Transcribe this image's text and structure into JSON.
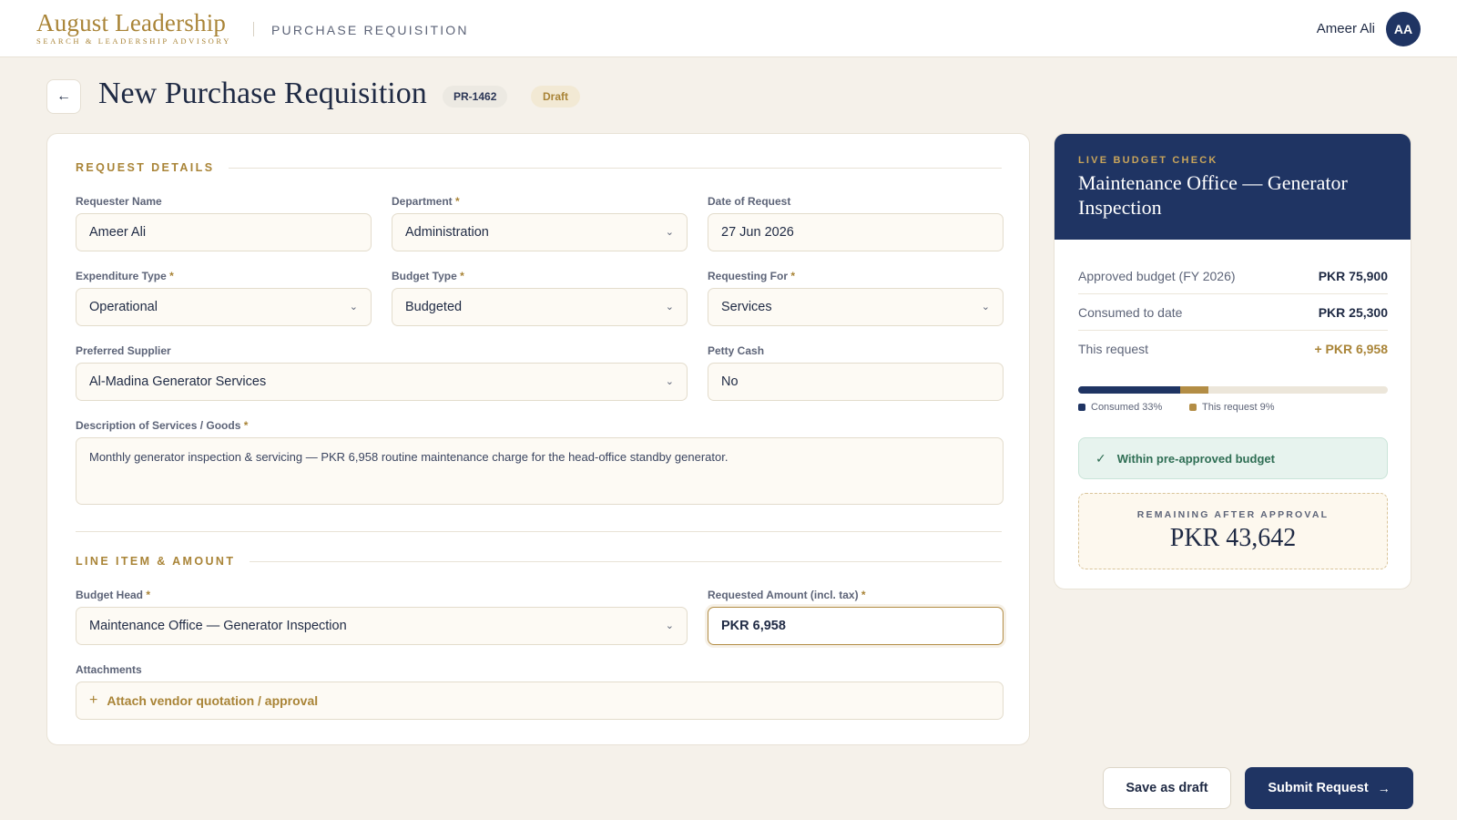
{
  "header": {
    "logo_main": "August Leadership",
    "logo_sub": "SEARCH & LEADERSHIP ADVISORY",
    "module": "PURCHASE REQUISITION",
    "user_name": "Ameer Ali",
    "user_initials": "AA"
  },
  "title_row": {
    "back_icon": "←",
    "title": "New Purchase Requisition",
    "pr_id": "PR-1462",
    "status": "Draft"
  },
  "request_details": {
    "section_title": "REQUEST DETAILS",
    "requester_name": {
      "label": "Requester Name",
      "value": "Ameer Ali"
    },
    "department": {
      "label": "Department",
      "value": "Administration"
    },
    "date_of_request": {
      "label": "Date of Request",
      "value": "27 Jun 2026"
    },
    "expenditure_type": {
      "label": "Expenditure Type",
      "value": "Operational"
    },
    "budget_type": {
      "label": "Budget Type",
      "value": "Budgeted"
    },
    "requesting_for": {
      "label": "Requesting For",
      "value": "Services"
    },
    "preferred_supplier": {
      "label": "Preferred Supplier",
      "value": "Al-Madina Generator Services"
    },
    "petty_cash": {
      "label": "Petty Cash",
      "value": "No"
    },
    "description": {
      "label": "Description of Services / Goods",
      "value": "Monthly generator inspection & servicing — PKR 6,958 routine maintenance charge for the head-office standby generator."
    },
    "required_marker": "*",
    "chevron_icon": "⌄"
  },
  "line_item": {
    "section_title": "LINE ITEM & AMOUNT",
    "budget_head": {
      "label": "Budget Head",
      "value": "Maintenance Office — Generator Inspection"
    },
    "requested_amount": {
      "label": "Requested Amount (incl. tax)",
      "value": "PKR 6,958"
    },
    "attachments": {
      "label": "Attachments",
      "action": "Attach vendor quotation / approval",
      "plus_icon": "+"
    }
  },
  "budget_check": {
    "eyebrow": "LIVE BUDGET CHECK",
    "title": "Maintenance Office — Generator Inspection",
    "approved_label": "Approved budget (FY 2026)",
    "approved_value": "PKR 75,900",
    "consumed_label": "Consumed to date",
    "consumed_value": "PKR 25,300",
    "request_label": "This request",
    "request_value": "+ PKR 6,958",
    "consumed_pct": 33,
    "request_pct": 9,
    "legend_consumed": "Consumed 33%",
    "legend_request": "This request 9%",
    "status_icon": "✓",
    "status_text": "Within pre-approved budget",
    "remaining_label": "REMAINING AFTER APPROVAL",
    "remaining_value": "PKR 43,642",
    "colors": {
      "consumed": "#1f3463",
      "request": "#b38d45",
      "ok": "#2f6e54"
    }
  },
  "actions": {
    "save_draft": "Save as draft",
    "submit": "Submit Request",
    "submit_icon": "→"
  }
}
